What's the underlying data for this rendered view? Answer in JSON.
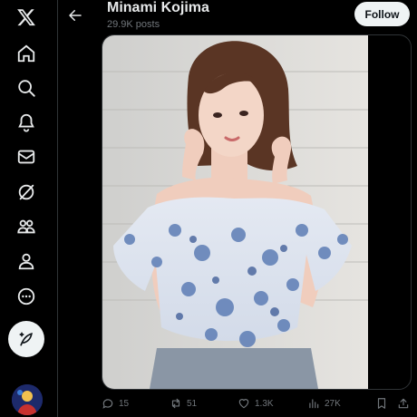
{
  "profile": {
    "name": "Minami Kojima",
    "posts_count": "29.9K posts",
    "follow_label": "Follow"
  },
  "nav": {
    "items": [
      {
        "icon": "x-logo-icon"
      },
      {
        "icon": "home-icon"
      },
      {
        "icon": "search-icon"
      },
      {
        "icon": "notifications-bell-icon"
      },
      {
        "icon": "messages-envelope-icon"
      },
      {
        "icon": "grok-slash-icon"
      },
      {
        "icon": "communities-icon"
      },
      {
        "icon": "profile-icon"
      },
      {
        "icon": "more-circle-icon"
      }
    ],
    "compose_icon": "compose-feather-icon"
  },
  "post": {
    "media_alt": "photo of a woman in a blue floral off-shoulder blouse making heart hands",
    "stats": {
      "replies": "15",
      "reposts": "51",
      "likes": "1.3K",
      "views": "27K"
    }
  },
  "colors": {
    "background": "#000000",
    "text": "#e7e9ea",
    "muted": "#71767b",
    "button_bg": "#eff3f4",
    "button_text": "#0f1419",
    "border": "#2f3336"
  }
}
